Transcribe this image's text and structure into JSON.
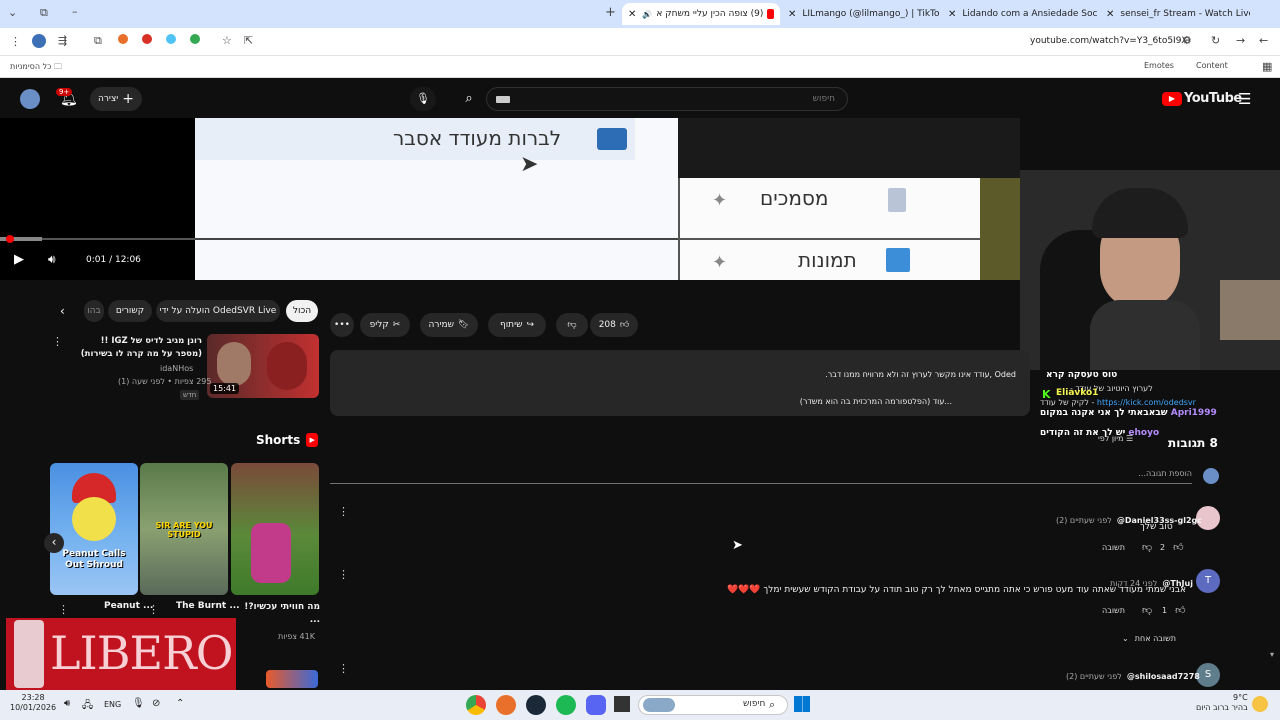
{
  "browser": {
    "tabs": [
      {
        "label": "sensei_fr Stream - Watch Live o",
        "active": false
      },
      {
        "label": "Lidando com a Ansiedade Soci",
        "active": false
      },
      {
        "label": "LILmango (@lilmango_) | TikTo",
        "active": false
      },
      {
        "label": "(9) צופה הכין עליי משחק א",
        "active": true
      }
    ],
    "new_tab": "+",
    "url": "youtube.com/watch?v=Y3_6to5I9XI",
    "bookmarks": [
      "Emotes",
      "Content"
    ],
    "all_bookmarks": "כל הסימניות"
  },
  "header": {
    "brand": "YouTube",
    "search_placeholder": "חיפוש",
    "create_label": "יצירה",
    "notif_badge": "9+"
  },
  "player": {
    "time": "0:01 / 12:06",
    "video_text_1": "לברות מעודד אסבר",
    "video_text_2": "מסמכים",
    "video_text_3": "תמונות"
  },
  "actions": {
    "likes": "208",
    "share": "שיתוף",
    "save": "שמירה",
    "clip": "קליפ",
    "more": "•••"
  },
  "description": {
    "line1": "Oded ,עודד אינו מקשר לערוץ זה ולא מרוויח ממנו דבר.",
    "line2": "...עוד  (הפלטפורמה המרכזית בה הוא משדר)"
  },
  "stream_chat": [
    {
      "user": "Eliavko1",
      "text": "",
      "color": "#f5f54f"
    },
    {
      "user": "Apri1999",
      "text": "שבאבאתי לך אני אקנה במקום",
      "color": "#b58cff"
    },
    {
      "user": "ehoyo",
      "text": "יש לך את זה הקודים",
      "color": "#b58cff"
    }
  ],
  "stream_misc": {
    "title_fragment": "טוס טעסקה קרא",
    "history": "לערוץ היוטיוב של עודד -",
    "kick_prefix": "לקיק של עודד -",
    "kick_link": "https://kick.com/odedsvr"
  },
  "comments_header": {
    "count": "8 תגובות",
    "sort": "מיון לפי",
    "add_placeholder": "הוספת תגובה..."
  },
  "comments": [
    {
      "user": "@Daniel33ss-gl2gc",
      "time": "לפני שעתיים (2)",
      "text": "טוב שלך",
      "likes": "2",
      "reply": "תשובה",
      "avatar_color": "#e8c5cc",
      "avatar_letter": ""
    },
    {
      "user": "@ThJuj",
      "time": "לפני 24 דקות",
      "text": "אבני שמתי מעודד שאתה עוד מעט פורש כי אתה מתגייס מאחל לך רק טוב תודה על עבודת הקודש שעשית ימלך ❤️❤️❤️",
      "likes": "1",
      "reply": "תשובה",
      "avatar_color": "#5c6bc0",
      "avatar_letter": "T"
    },
    {
      "user": "@shilosaad7278",
      "time": "לפני שעתיים (2)",
      "text": "",
      "likes": "",
      "reply": "",
      "avatar_color": "#607d8b",
      "avatar_letter": "S"
    }
  ],
  "replies_toggle": "תשובה אחת",
  "chips": [
    "הכול",
    "הועלה על ידי OdedSVR Live",
    "קשורים",
    "בהו"
  ],
  "related": {
    "title": "רונן מגיב לדיס של IGZ !! (מספר על מה קרה לו בשירות)",
    "channel": "idaNHos",
    "meta": "295 צפיות • לפני שעה (1)",
    "badge": "חדש",
    "duration": "15:41"
  },
  "shorts": {
    "section_title": "Shorts",
    "items": [
      {
        "title": "מה חוויתי עכשיו?! ...",
        "views": "41K צפיות",
        "thumb_text": ""
      },
      {
        "title": "The Burnt ...",
        "views": "",
        "thumb_text": "SIR ARE YOU STUPID"
      },
      {
        "title": "Peanut ...",
        "views": "",
        "thumb_text": "Peanut Calls Out Shroud"
      }
    ]
  },
  "ad": {
    "brand": "LIBERO"
  },
  "taskbar": {
    "search": "חיפוש",
    "clock": "23:28",
    "date": "10/01/2026",
    "lang": "ENG",
    "weather_temp": "9°C",
    "weather_text": "בהיר ברוב היום"
  },
  "colors": {
    "accent": "#ff0000",
    "bg": "#0f0f0f",
    "chrome": "#d3e3fd"
  }
}
